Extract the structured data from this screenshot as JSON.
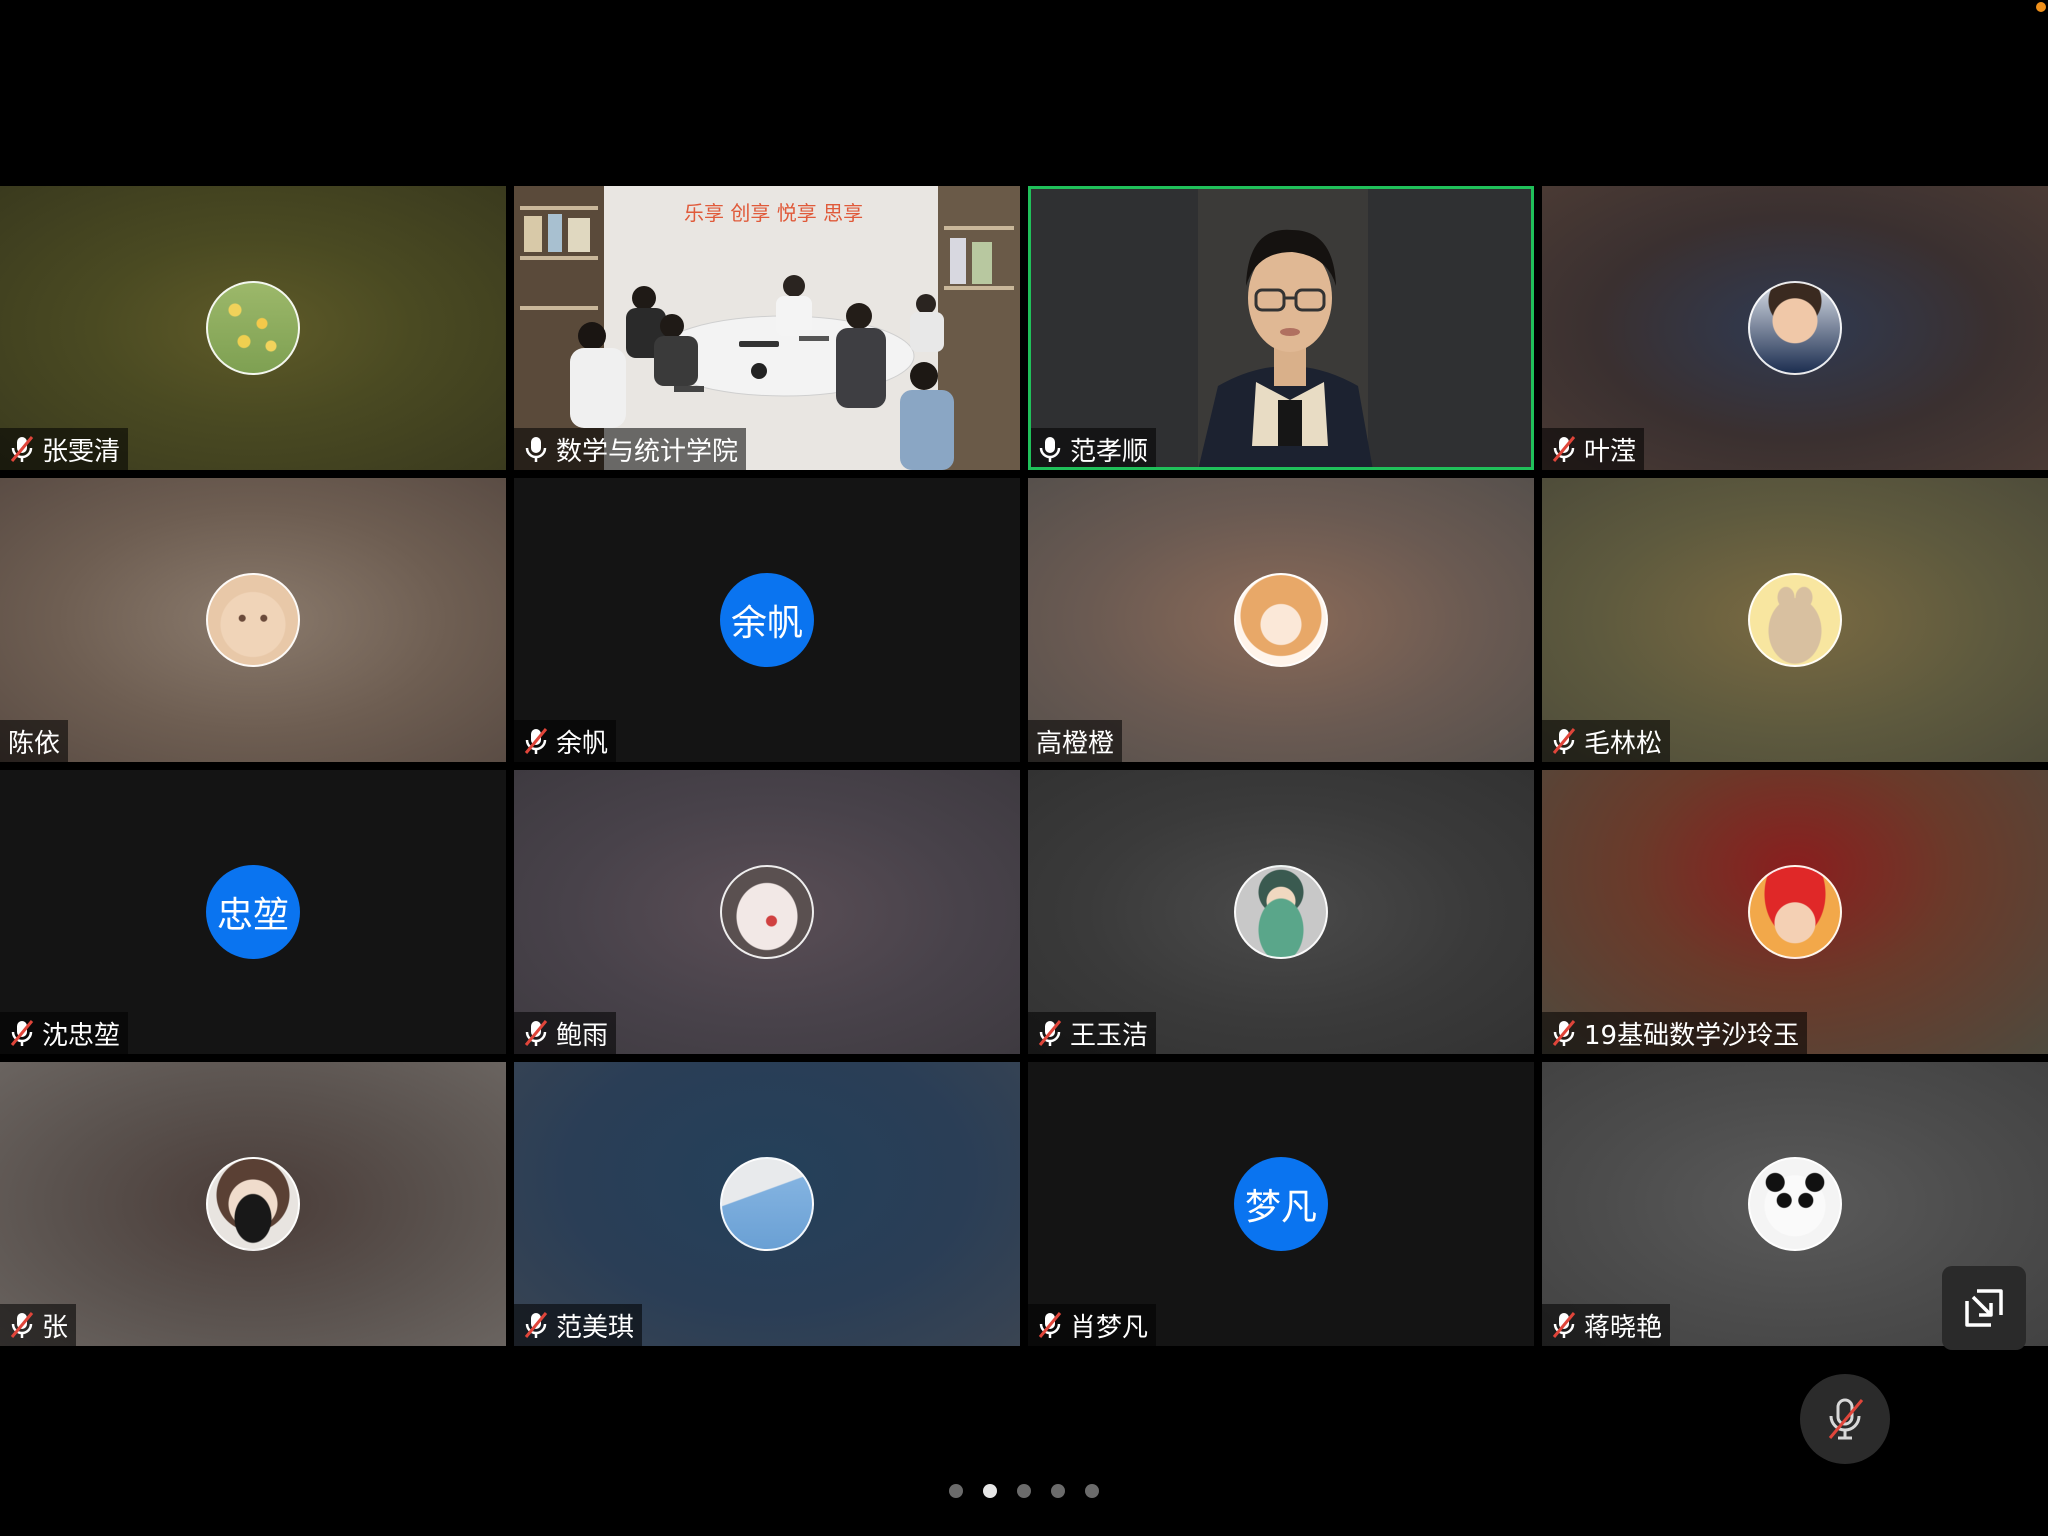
{
  "participants": [
    {
      "name": "张雯清",
      "muted": true,
      "avatar_icon": "flower-field-avatar-icon"
    },
    {
      "name": "数学与统计学院",
      "muted": false,
      "video": "meeting-room-video",
      "wall_text": "乐享  创享  悦享  思享"
    },
    {
      "name": "范孝顺",
      "muted": false,
      "video": "speaker-webcam-video",
      "active_speaker": true
    },
    {
      "name": "叶滢",
      "muted": true,
      "avatar_icon": "baby-photo-avatar-icon"
    },
    {
      "name": "陈依",
      "muted": null,
      "avatar_icon": "cartoon-bun-avatar-icon"
    },
    {
      "name": "余帆",
      "muted": true,
      "avatar_text": "余帆"
    },
    {
      "name": "高橙橙",
      "muted": null,
      "avatar_icon": "anime-girl-avatar-icon"
    },
    {
      "name": "毛林松",
      "muted": true,
      "avatar_icon": "cartoon-rabbit-avatar-icon"
    },
    {
      "name": "沈忠堃",
      "muted": true,
      "avatar_text": "忠堃"
    },
    {
      "name": "鲍雨",
      "muted": true,
      "avatar_icon": "illustration-girl-avatar-icon"
    },
    {
      "name": "王玉洁",
      "muted": true,
      "avatar_icon": "anime-character-avatar-icon"
    },
    {
      "name": "19基础数学沙玲玉",
      "muted": true,
      "avatar_icon": "baby-red-hat-avatar-icon"
    },
    {
      "name": "张",
      "muted": true,
      "avatar_icon": "masked-girl-avatar-icon"
    },
    {
      "name": "范美琪",
      "muted": true,
      "avatar_icon": "sky-wall-avatar-icon"
    },
    {
      "name": "肖梦凡",
      "muted": true,
      "avatar_text": "梦凡"
    },
    {
      "name": "蒋晓艳",
      "muted": true,
      "avatar_icon": "panda-avatar-icon"
    }
  ],
  "pager": {
    "pages": 5,
    "current": 2
  },
  "controls": {
    "float_window_icon": "exit-fullscreen-icon",
    "mute_icon": "microphone-muted-icon"
  },
  "colors": {
    "active_speaker_border": "#20c05a",
    "avatar_blue": "#0a74f0",
    "muted_mic_red": "#e0453a",
    "status_dot": "#f0901a"
  }
}
